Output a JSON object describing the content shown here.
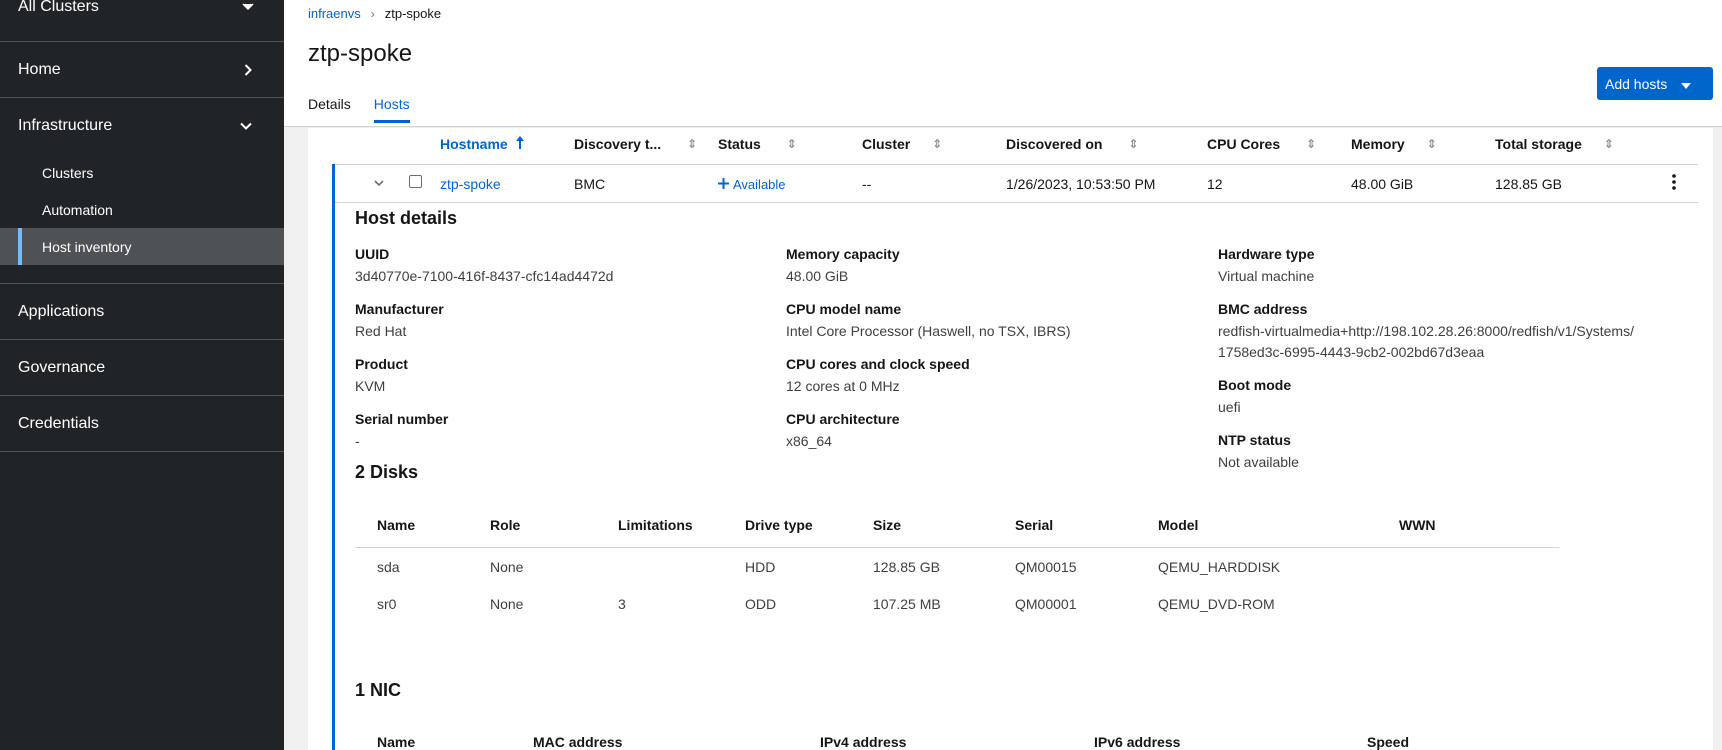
{
  "sidebar": {
    "cluster_switcher": "All Clusters",
    "sections": [
      {
        "label": "Home"
      },
      {
        "label": "Infrastructure"
      },
      {
        "label": "Applications"
      },
      {
        "label": "Governance"
      },
      {
        "label": "Credentials"
      }
    ],
    "infrastructure_items": [
      {
        "label": "Clusters"
      },
      {
        "label": "Automation"
      },
      {
        "label": "Host inventory"
      }
    ]
  },
  "header": {
    "breadcrumb": [
      "infraenvs",
      "ztp-spoke"
    ],
    "title": "ztp-spoke",
    "tabs": [
      {
        "label": "Details"
      },
      {
        "label": "Hosts"
      }
    ],
    "add_hosts_label": "Add hosts"
  },
  "hosts_table": {
    "columns": [
      "Hostname",
      "Discovery t...",
      "Status",
      "Cluster",
      "Discovered on",
      "CPU Cores",
      "Memory",
      "Total storage"
    ],
    "row": {
      "hostname": "ztp-spoke",
      "discovery_type": "BMC",
      "status": "Available",
      "cluster": "--",
      "discovered_on": "1/26/2023, 10:53:50 PM",
      "cpu_cores": "12",
      "memory": "48.00 GiB",
      "total_storage": "128.85 GB"
    }
  },
  "host_details": {
    "title": "Host details",
    "col1": [
      {
        "label": "UUID",
        "value": "3d40770e-7100-416f-8437-cfc14ad4472d"
      },
      {
        "label": "Manufacturer",
        "value": "Red Hat"
      },
      {
        "label": "Product",
        "value": "KVM"
      },
      {
        "label": "Serial number",
        "value": "-"
      }
    ],
    "col2": [
      {
        "label": "Memory capacity",
        "value": "48.00 GiB"
      },
      {
        "label": "CPU model name",
        "value": "Intel Core Processor (Haswell, no TSX, IBRS)"
      },
      {
        "label": "CPU cores and clock speed",
        "value": "12 cores at 0 MHz"
      },
      {
        "label": "CPU architecture",
        "value": "x86_64"
      }
    ],
    "col3": [
      {
        "label": "Hardware type",
        "value": "Virtual machine"
      },
      {
        "label": "BMC address",
        "value": "redfish-virtualmedia+http://198.102.28.26:8000/redfish/v1/Systems/1758ed3c-6995-4443-9cb2-002bd67d3eaa"
      },
      {
        "label": "Boot mode",
        "value": "uefi"
      },
      {
        "label": "NTP status",
        "value": "Not available"
      }
    ]
  },
  "disks": {
    "title": "2 Disks",
    "columns": [
      "Name",
      "Role",
      "Limitations",
      "Drive type",
      "Size",
      "Serial",
      "Model",
      "WWN"
    ],
    "rows": [
      {
        "name": "sda",
        "role": "None",
        "limitations": "",
        "drive_type": "HDD",
        "size": "128.85 GB",
        "serial": "QM00015",
        "model": "QEMU_HARDDISK",
        "wwn": ""
      },
      {
        "name": "sr0",
        "role": "None",
        "limitations": "3",
        "drive_type": "ODD",
        "size": "107.25 MB",
        "serial": "QM00001",
        "model": "QEMU_DVD-ROM",
        "wwn": ""
      }
    ]
  },
  "nics": {
    "title": "1 NIC",
    "columns": [
      "Name",
      "MAC address",
      "IPv4 address",
      "IPv6 address",
      "Speed"
    ]
  },
  "colors": {
    "accent": "#0066cc",
    "sidebar_bg": "#212427",
    "sidebar_active": "#4f5255"
  }
}
